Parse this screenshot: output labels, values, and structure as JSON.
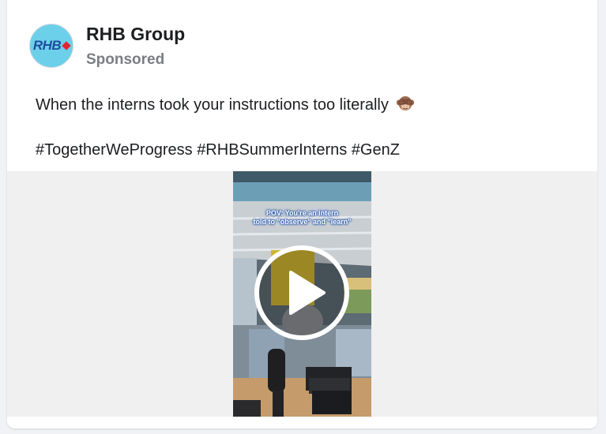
{
  "post": {
    "page_name": "RHB Group",
    "sponsored_label": "Sponsored",
    "avatar_text": "RHB",
    "text": "When the interns took your instructions too literally",
    "emoji": "see-no-evil-monkey",
    "hashtags": [
      "#TogetherWeProgress",
      "#RHBSummerInterns",
      "#GenZ"
    ]
  },
  "video": {
    "caption_line1": "POV: You're an intern",
    "caption_line2": "told to \"observe\" and \"learn\"",
    "play_icon": "play-icon"
  },
  "colors": {
    "avatar_bg": "#6dd0ea",
    "brand_blue": "#1d4e9f",
    "brand_red": "#e3262e",
    "sponsored_gray": "#7a7d82",
    "media_bg": "#f0f0f0"
  }
}
